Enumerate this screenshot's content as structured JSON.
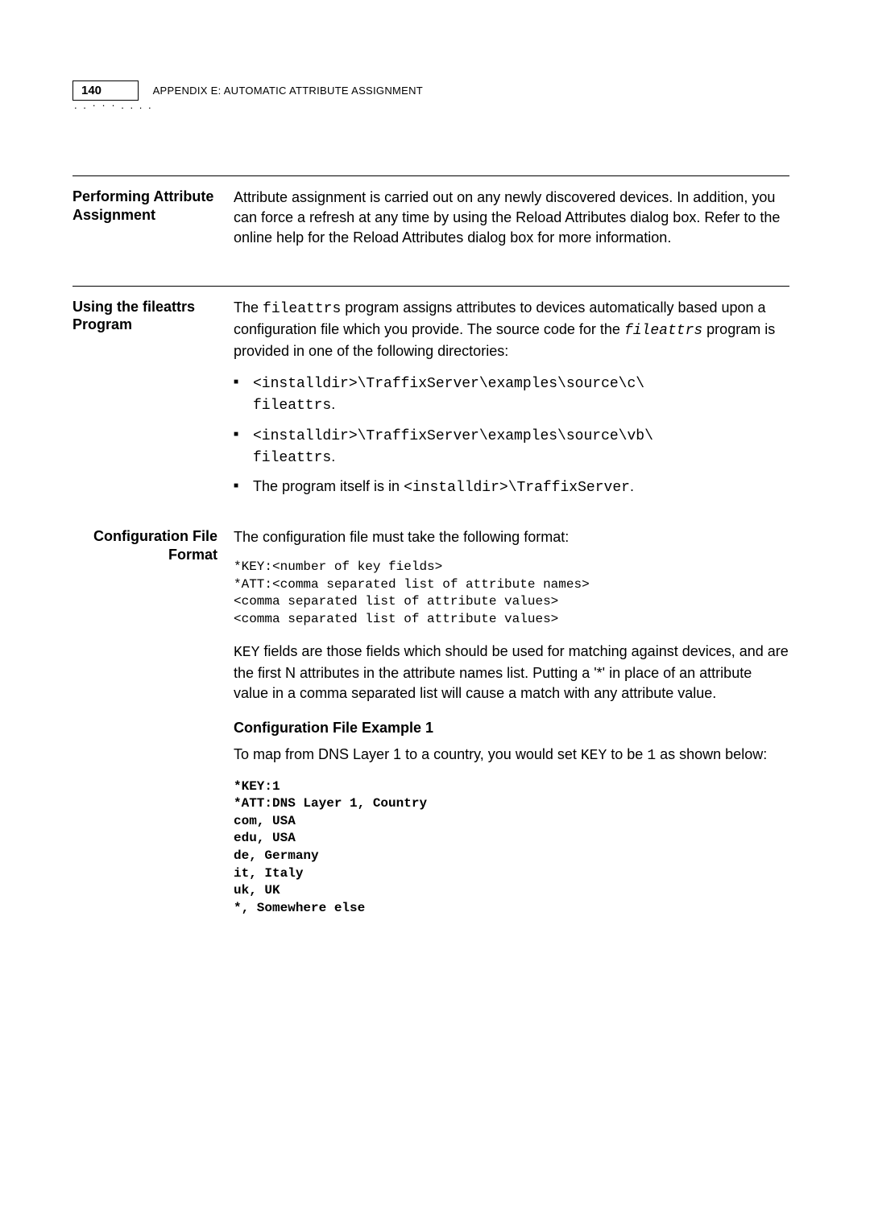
{
  "header": {
    "page_number": "140",
    "appendix_label": "APPENDIX E: AUTOMATIC ATTRIBUTE ASSIGNMENT",
    "dots": ". . · · · . . . ."
  },
  "section1": {
    "heading": "Performing Attribute Assignment",
    "body": "Attribute assignment is carried out on any newly discovered devices. In addition, you can force a refresh at any time by using the Reload Attributes dialog box. Refer to the online help for the Reload Attributes dialog box for more information."
  },
  "section2": {
    "heading": "Using the fileattrs Program",
    "body_pre": "The ",
    "body_code1": "fileattrs",
    "body_mid": " program assigns attributes to devices automatically based upon a configuration file which you provide. The source code for the ",
    "body_code2": "fileattrs",
    "body_post": " program is provided in one of the following directories:",
    "bullet1_a": "<installdir>\\TraffixServer\\examples\\source\\c\\",
    "bullet1_b": "fileattrs",
    "bullet1_c": ".",
    "bullet2_a": "<installdir>\\TraffixServer\\examples\\source\\vb\\",
    "bullet2_b": "fileattrs",
    "bullet2_c": ".",
    "bullet3_a": "The program itself is in ",
    "bullet3_b": "<installdir>\\TraffixServer",
    "bullet3_c": "."
  },
  "subsection": {
    "heading": "Configuration File Format",
    "intro": "The configuration file must take the following format:",
    "code1": "*KEY:<number of key fields>\n*ATT:<comma separated list of attribute names>\n<comma separated list of attribute values>\n<comma separated list of attribute values>",
    "para2_a": "KEY",
    "para2_b": " fields are those fields which should be used for matching against devices, and are the first N attributes in the attribute names list. Putting a '*' in place of an attribute value in a comma separated list will cause a match with any attribute value.",
    "example_heading": "Configuration File Example 1",
    "example_intro_a": "To map from DNS Layer 1 to a country, you would set ",
    "example_intro_b": "KEY",
    "example_intro_c": " to be ",
    "example_intro_d": "1",
    "example_intro_e": "  as shown below:",
    "code2": "*KEY:1\n*ATT:DNS Layer 1, Country\ncom, USA\nedu, USA\nde, Germany\nit, Italy\nuk, UK\n*, Somewhere else"
  }
}
